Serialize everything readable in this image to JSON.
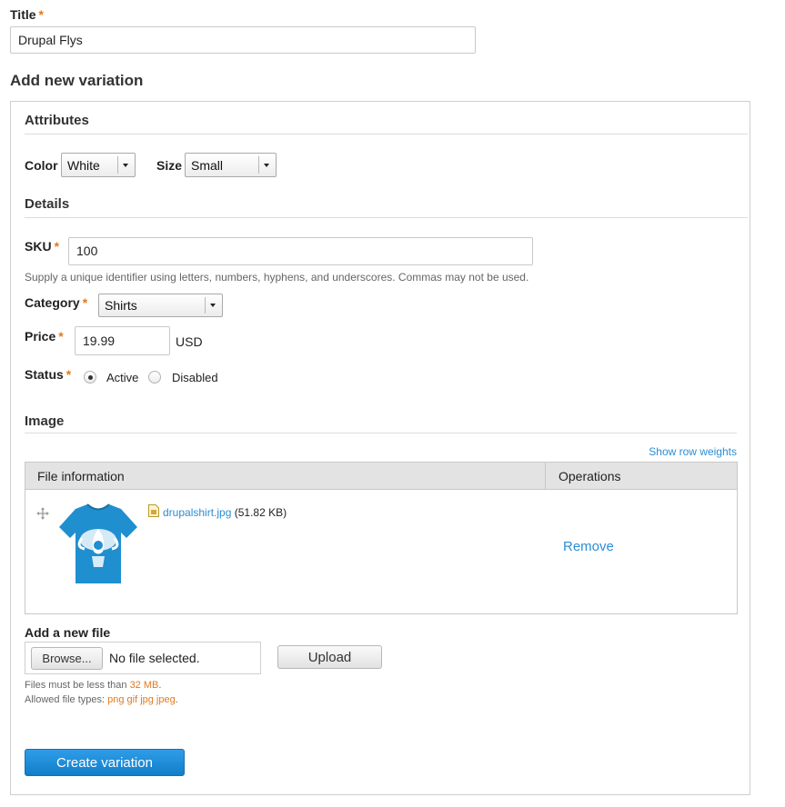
{
  "title_field": {
    "label": "Title",
    "required_mark": "*",
    "value": "Drupal Flys"
  },
  "section_heading": "Add new variation",
  "attributes": {
    "heading": "Attributes",
    "color": {
      "label": "Color",
      "value": "White"
    },
    "size": {
      "label": "Size",
      "value": "Small"
    }
  },
  "details": {
    "heading": "Details",
    "sku": {
      "label": "SKU",
      "required_mark": "*",
      "value": "100",
      "description": "Supply a unique identifier using letters, numbers, hyphens, and underscores. Commas may not be used."
    },
    "category": {
      "label": "Category",
      "required_mark": "*",
      "value": "Shirts"
    },
    "price": {
      "label": "Price",
      "required_mark": "*",
      "value": "19.99",
      "currency": "USD"
    },
    "status": {
      "label": "Status",
      "required_mark": "*",
      "options": [
        {
          "label": "Active",
          "selected": true
        },
        {
          "label": "Disabled",
          "selected": false
        }
      ]
    }
  },
  "image": {
    "heading": "Image",
    "show_row_weights": "Show row weights",
    "table": {
      "headers": [
        "File information",
        "Operations"
      ],
      "rows": [
        {
          "filename": "drupalshirt.jpg",
          "size": "(51.82 KB)",
          "operation": "Remove"
        }
      ]
    }
  },
  "add_file": {
    "label": "Add a new file",
    "browse_label": "Browse...",
    "no_file_text": "No file selected.",
    "upload_label": "Upload",
    "size_limit_prefix": "Files must be less than ",
    "size_limit_value": "32 MB",
    "size_limit_suffix": ".",
    "types_prefix": "Allowed file types: ",
    "types_value": "png gif jpg jpeg",
    "types_suffix": "."
  },
  "submit_label": "Create variation",
  "colors": {
    "accent": "#2a8ed4",
    "required": "#e07a1f",
    "shirt": "#1f8fd0",
    "button": "#168bd8"
  }
}
